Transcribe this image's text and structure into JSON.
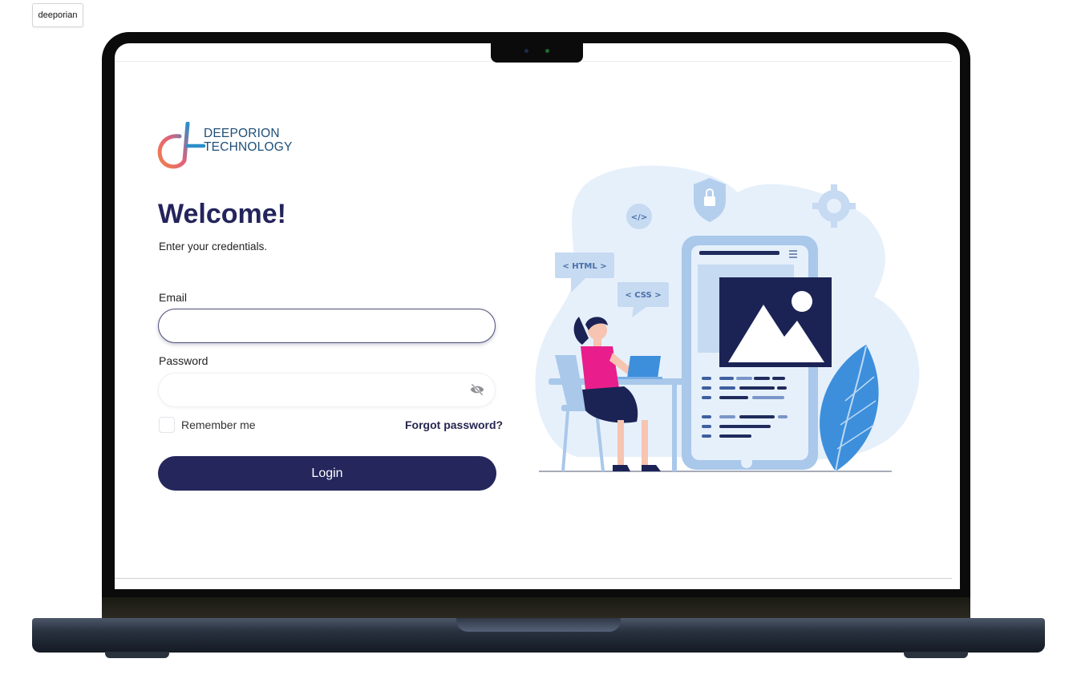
{
  "top_button": {
    "label": "deeporian"
  },
  "brand": {
    "line1": "DEEPORION",
    "line2": "TECHNOLOGY"
  },
  "login": {
    "heading": "Welcome!",
    "subtitle": "Enter your credentials.",
    "email_label": "Email",
    "email_value": "",
    "password_label": "Password",
    "password_value": "",
    "remember_label": "Remember me",
    "remember_checked": false,
    "forgot_label": "Forgot password?",
    "submit_label": "Login"
  },
  "illustration": {
    "html_bubble": "< HTML >",
    "css_bubble": "< CSS >",
    "code_icon": "</>"
  },
  "colors": {
    "primary": "#24265c",
    "brand_blue": "#1e4f78",
    "illustration_light": "#e6f0fb",
    "illustration_mid": "#a9c8ea",
    "accent_pink": "#e91e8c"
  },
  "icons": [
    "eye-off-icon",
    "shield-lock-icon",
    "gear-icon",
    "image-icon",
    "code-icon"
  ]
}
